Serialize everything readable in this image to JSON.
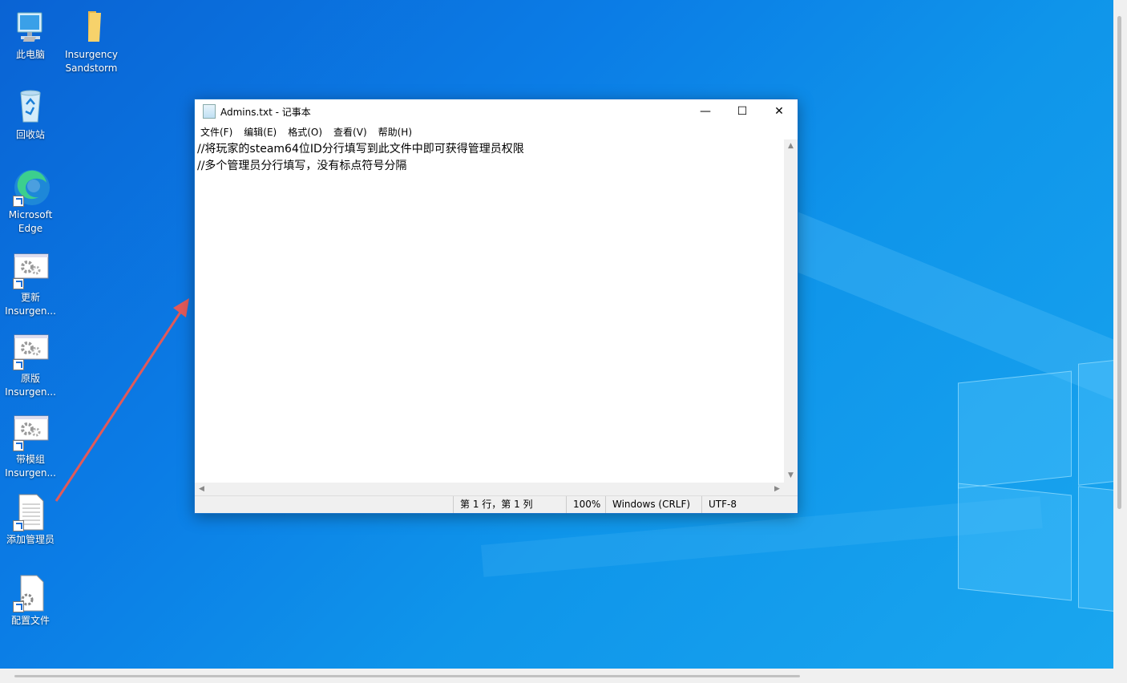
{
  "desktop": {
    "icons": [
      {
        "label": "此电脑",
        "icon": "computer-icon"
      },
      {
        "label": "Insurgency Sandstorm",
        "icon": "folder-icon"
      },
      {
        "label": "回收站",
        "icon": "recycle-bin-icon"
      },
      {
        "label": "Microsoft Edge",
        "icon": "edge-icon"
      },
      {
        "label": "更新 Insurgen...",
        "icon": "gear-window-icon"
      },
      {
        "label": "原版 Insurgen...",
        "icon": "gear-window-icon"
      },
      {
        "label": "带模组 Insurgen...",
        "icon": "gear-window-icon"
      },
      {
        "label": "添加管理员",
        "icon": "text-file-icon"
      },
      {
        "label": "配置文件",
        "icon": "config-file-icon"
      }
    ]
  },
  "notepad": {
    "title": "Admins.txt - 记事本",
    "controls": {
      "minimize": "—",
      "maximize": "☐",
      "close": "✕"
    },
    "menu": [
      "文件(F)",
      "编辑(E)",
      "格式(O)",
      "查看(V)",
      "帮助(H)"
    ],
    "content": [
      "//将玩家的steam64位ID分行填写到此文件中即可获得管理员权限",
      "//多个管理员分行填写，没有标点符号分隔"
    ],
    "status": {
      "position": "第 1 行，第 1 列",
      "zoom": "100%",
      "line_ending": "Windows (CRLF)",
      "encoding": "UTF-8"
    }
  },
  "colors": {
    "annotation_arrow": "#e05a5a",
    "desktop_blue": "#0b7de6"
  }
}
